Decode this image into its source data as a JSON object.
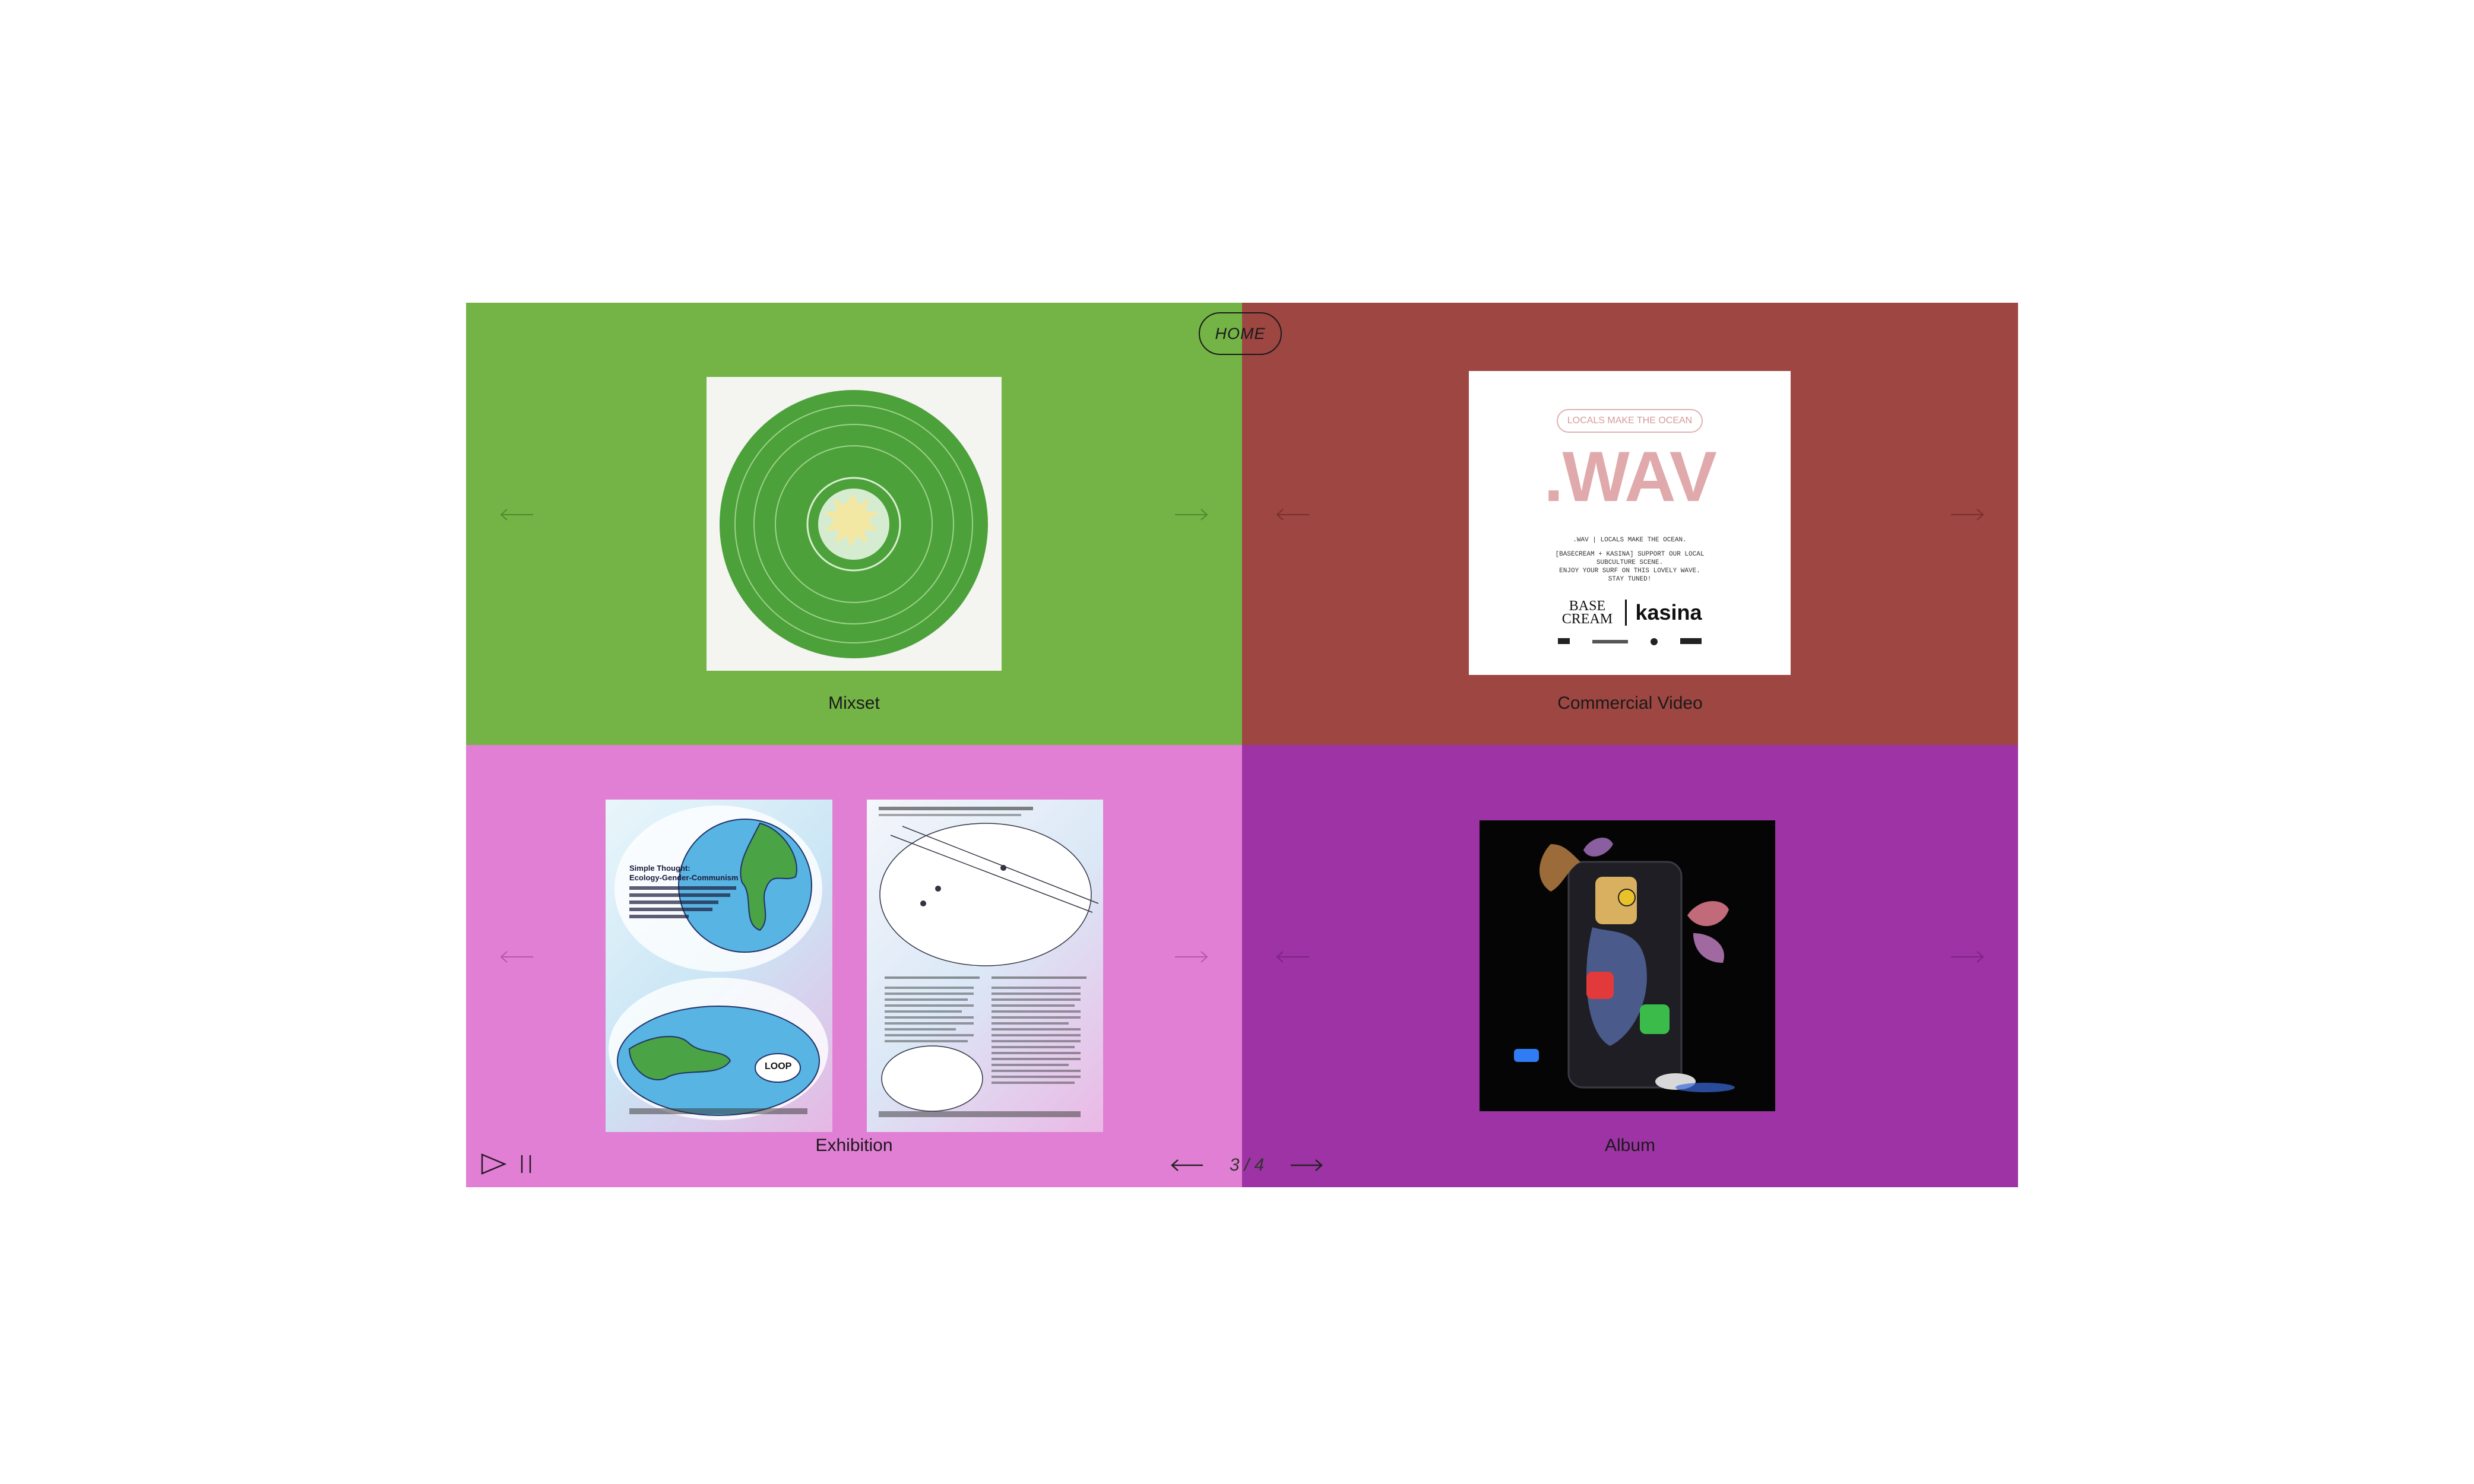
{
  "nav": {
    "home_label": "HOME"
  },
  "pager": {
    "current": 3,
    "total": 4,
    "text": "3 / 4"
  },
  "quadrants": [
    {
      "label": "Mixset",
      "color": "#74b447"
    },
    {
      "label": "Commercial Video",
      "color": "#9d4642"
    },
    {
      "label": "Exhibition",
      "color": "#e17fd4"
    },
    {
      "label": "Album",
      "color": "#9d33a4"
    }
  ],
  "wav_poster": {
    "pill": "LOCALS MAKE THE OCEAN",
    "title": ".WAV",
    "line1": ".WAV | LOCALS MAKE THE OCEAN.",
    "line2": "[BASECREAM + KASINA] SUPPORT OUR LOCAL",
    "line3": "SUBCULTURE SCENE.",
    "line4": "ENJOY YOUR SURF ON THIS LOVELY WAVE.",
    "line5": "STAY TUNED!",
    "brand1": "BASE CREAM",
    "brand2": "kasina"
  },
  "exhibition_poster": {
    "title1": "Simple Thought:",
    "title2": "Ecology-Gender-Communism",
    "loop": "LOOP"
  },
  "icons": [
    "arrow-left-icon",
    "arrow-right-icon",
    "play-icon",
    "pause-icon"
  ]
}
